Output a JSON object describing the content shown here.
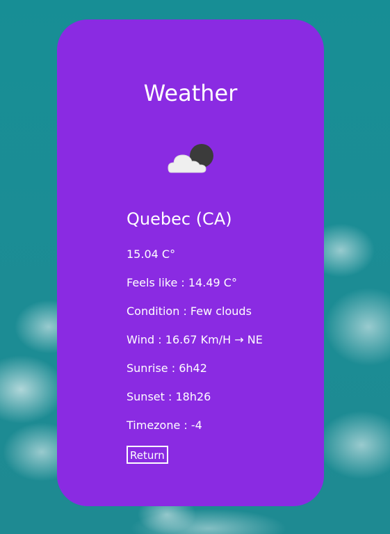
{
  "title": "Weather",
  "icon": "few-clouds-night-icon",
  "location": "Quebec (CA)",
  "temperature": "15.04 C°",
  "feels_like": "Feels like : 14.49 C°",
  "condition": "Condition : Few clouds",
  "wind": "Wind : 16.67 Km/H → NE",
  "sunrise": "Sunrise : 6h42",
  "sunset": "Sunset : 18h26",
  "timezone": "Timezone : -4",
  "return_label": "Return",
  "colors": {
    "card": "#8a2be2",
    "background": "#1a8a93",
    "text": "#ffffff"
  }
}
